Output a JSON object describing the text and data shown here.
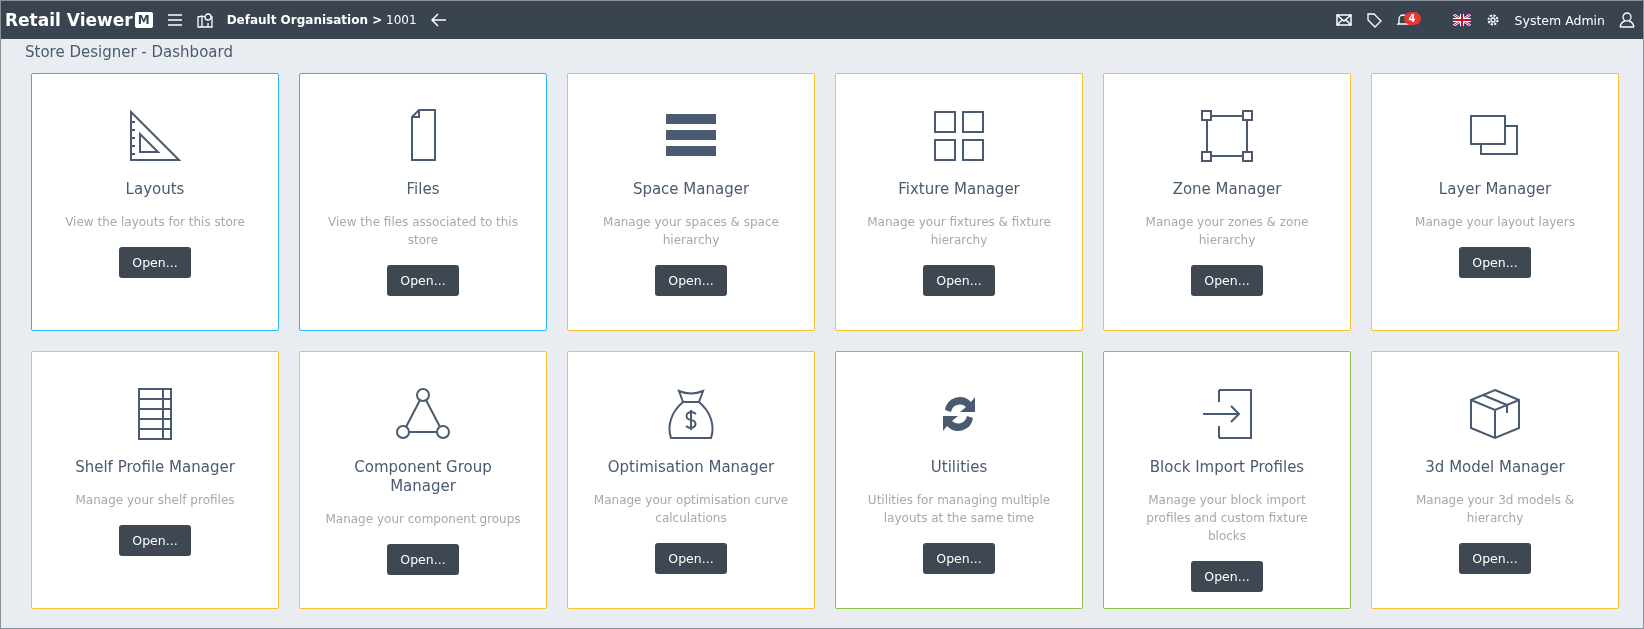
{
  "topbar": {
    "logo": "Retail Viewer",
    "logo_mark": "M",
    "breadcrumb": "**Default Organisation >** 1001",
    "notification_count": "4",
    "user": "System Admin"
  },
  "page_title": "Store Designer - Dashboard",
  "cards": [
    {
      "kind": "set-square",
      "title": "Layouts",
      "description": "View the layouts for this store",
      "button": "Open...",
      "color": "#29b6f6"
    },
    {
      "kind": "file",
      "title": "Files",
      "description": "View the files associated to this store",
      "button": "Open...",
      "color": "#29b6f6"
    },
    {
      "kind": "bars",
      "title": "Space Manager",
      "description": "Manage your spaces & space hierarchy",
      "button": "Open...",
      "color": "#fbc02d"
    },
    {
      "kind": "grid",
      "title": "Fixture Manager",
      "description": "Manage your fixtures & fixture hierarchy",
      "button": "Open...",
      "color": "#fbc02d"
    },
    {
      "kind": "zone",
      "title": "Zone Manager",
      "description": "Manage your zones & zone hierarchy",
      "button": "Open...",
      "color": "#fbc02d"
    },
    {
      "kind": "layers",
      "title": "Layer Manager",
      "description": "Manage your layout layers",
      "button": "Open...",
      "color": "#fbc02d"
    },
    {
      "kind": "shelf",
      "title": "Shelf Profile Manager",
      "description": "Manage your shelf profiles",
      "button": "Open...",
      "color": "#fbc02d"
    },
    {
      "kind": "triangle",
      "title": "Component Group Manager",
      "description": "Manage your component groups",
      "button": "Open...",
      "color": "#fbc02d"
    },
    {
      "kind": "money-bag",
      "title": "Optimisation Manager",
      "description": "Manage your optimisation curve calculations",
      "button": "Open...",
      "color": "#fbc02d"
    },
    {
      "kind": "refresh",
      "title": "Utilities",
      "description": "Utilities for managing multiple layouts at the same time",
      "button": "Open...",
      "color": "#8bc34a"
    },
    {
      "kind": "import",
      "title": "Block Import Profiles",
      "description": "Manage your block import profiles and custom fixture blocks",
      "button": "Open...",
      "color": "#8bc34a"
    },
    {
      "kind": "cube",
      "title": "3d Model Manager",
      "description": "Manage your 3d models & hierarchy",
      "button": "Open...",
      "color": "#fbc02d"
    }
  ]
}
